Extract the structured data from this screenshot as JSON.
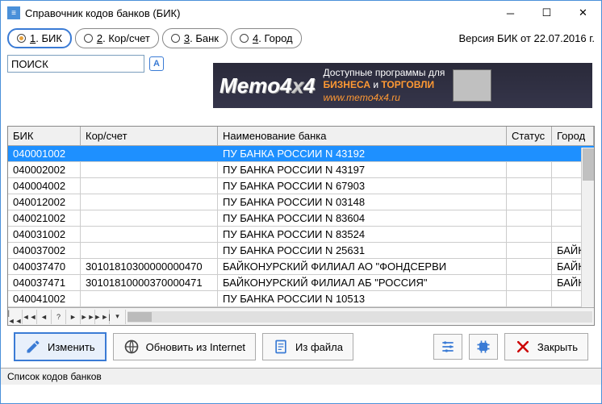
{
  "window": {
    "title": "Справочник кодов банков (БИК)"
  },
  "version": "Версия БИК от 22.07.2016 г.",
  "tabs": [
    {
      "label": "1. БИК",
      "underline": "1"
    },
    {
      "label": "2. Кор/счет",
      "underline": "2"
    },
    {
      "label": "3. Банк",
      "underline": "3"
    },
    {
      "label": "4. Город",
      "underline": "4"
    }
  ],
  "search": {
    "value": "ПОИСК",
    "a_label": "А"
  },
  "banner": {
    "logo": "Memo4x4",
    "line1": "Доступные программы для",
    "line2a": "БИЗНЕСА",
    "line2b": " и ",
    "line2c": "ТОРГОВЛИ",
    "url": "www.memo4x4.ru"
  },
  "columns": {
    "bik": "БИК",
    "kor": "Кор/счет",
    "name": "Наименование банка",
    "status": "Статус",
    "city": "Город"
  },
  "rows": [
    {
      "bik": "040001002",
      "kor": "",
      "name": "ПУ БАНКА РОССИИ N 43192",
      "status": "",
      "city": ""
    },
    {
      "bik": "040002002",
      "kor": "",
      "name": "ПУ БАНКА РОССИИ N 43197",
      "status": "",
      "city": ""
    },
    {
      "bik": "040004002",
      "kor": "",
      "name": "ПУ БАНКА РОССИИ N 67903",
      "status": "",
      "city": ""
    },
    {
      "bik": "040012002",
      "kor": "",
      "name": "ПУ БАНКА РОССИИ N 03148",
      "status": "",
      "city": ""
    },
    {
      "bik": "040021002",
      "kor": "",
      "name": "ПУ БАНКА РОССИИ N 83604",
      "status": "",
      "city": ""
    },
    {
      "bik": "040031002",
      "kor": "",
      "name": "ПУ БАНКА РОССИИ N 83524",
      "status": "",
      "city": ""
    },
    {
      "bik": "040037002",
      "kor": "",
      "name": "ПУ БАНКА РОССИИ N 25631",
      "status": "",
      "city": "БАЙК"
    },
    {
      "bik": "040037470",
      "kor": "30101810300000000470",
      "name": "БАЙКОНУРСКИЙ ФИЛИАЛ АО \"ФОНДСЕРВИ",
      "status": "",
      "city": "БАЙК"
    },
    {
      "bik": "040037471",
      "kor": "30101810000370000471",
      "name": "БАЙКОНУРСКИЙ ФИЛИАЛ АБ \"РОССИЯ\"",
      "status": "",
      "city": "БАЙК"
    },
    {
      "bik": "040041002",
      "kor": "",
      "name": "ПУ БАНКА РОССИИ N 10513",
      "status": "",
      "city": ""
    }
  ],
  "buttons": {
    "edit": "Изменить",
    "update": "Обновить из Internet",
    "fromfile": "Из файла",
    "close": "Закрыть"
  },
  "statusbar": "Список кодов банков",
  "nav": {
    "first": "|◄◄",
    "prev2": "◄◄",
    "prev": "◄",
    "info": "?",
    "next": "►",
    "next2": "►►",
    "last": "►►|",
    "filter": "▾"
  }
}
